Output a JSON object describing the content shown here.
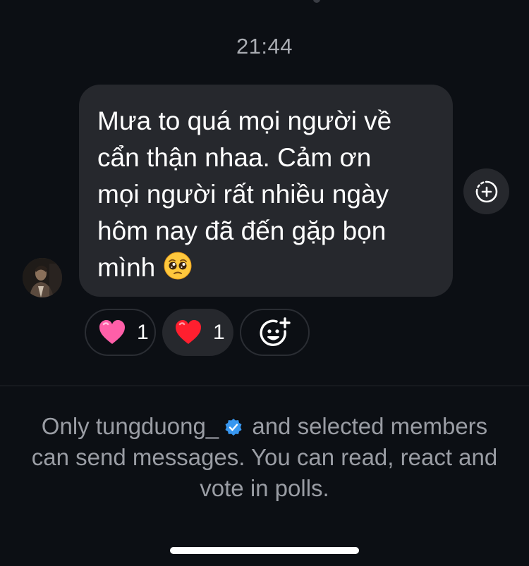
{
  "timestamp": "21:44",
  "message": {
    "text": "Mưa to quá mọi người về\ncẩn thận nhaa. Cảm ơn\nmọi người rất nhiều ngày\nhôm nay đã đến gặp bọn\nmình",
    "emoji": "pleading-face-emoji"
  },
  "reactions": [
    {
      "emoji": "pink-heart",
      "count": "1",
      "color": "#ff5fa8"
    },
    {
      "emoji": "red-heart",
      "count": "1",
      "color": "#ff1f2f"
    }
  ],
  "icons": {
    "share": "add-to-story-icon",
    "add_reaction": "add-reaction-icon"
  },
  "notice": {
    "prefix": "Only tungduong_",
    "suffix": " and selected members can send messages. You can read, react and vote in polls."
  },
  "colors": {
    "background": "#0c0f14",
    "bubble": "#26282d",
    "verified": "#3897f0"
  }
}
